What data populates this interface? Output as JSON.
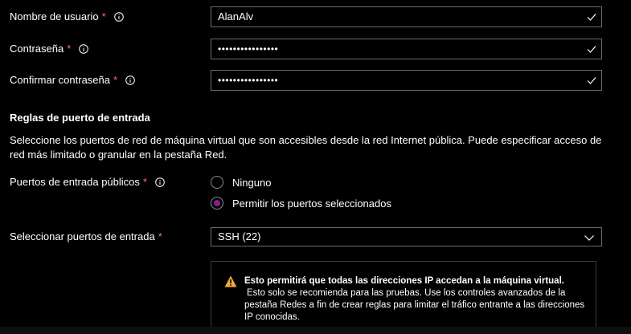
{
  "form": {
    "username": {
      "label": "Nombre de usuario",
      "required_mark": "*",
      "value": "AlanAlv"
    },
    "password": {
      "label": "Contraseña",
      "required_mark": "*",
      "value": "••••••••••••••••"
    },
    "confirm_password": {
      "label": "Confirmar contraseña",
      "required_mark": "*",
      "value": "••••••••••••••••"
    }
  },
  "inbound_rules": {
    "title": "Reglas de puerto de entrada",
    "description": "Seleccione los puertos de red de máquina virtual que son accesibles desde la red Internet pública. Puede especificar acceso de red más limitado o granular en la pestaña Red.",
    "public_ports": {
      "label": "Puertos de entrada públicos",
      "required_mark": "*",
      "options": [
        {
          "label": "Ninguno",
          "selected": false
        },
        {
          "label": "Permitir los puertos seleccionados",
          "selected": true
        }
      ]
    },
    "select_ports": {
      "label": "Seleccionar puertos de entrada",
      "required_mark": "*",
      "value": "SSH (22)"
    },
    "warning": {
      "bold_text": "Esto permitirá que todas las direcciones IP accedan a la máquina virtual.",
      "body_text": "Esto solo se recomienda para las pruebas.  Use los controles avanzados de la pestaña Redes a fin de crear reglas para limitar el tráfico entrante a las direcciones IP conocidas."
    }
  },
  "colors": {
    "background": "#000000",
    "required": "#f1707b",
    "radio_selected": "#8b1a8b",
    "warning_icon": "#f2a93b",
    "border": "#6b6b6b"
  },
  "icons": {
    "info": "info-icon",
    "check": "check-icon",
    "chevron": "chevron-down-icon",
    "warning": "warning-icon"
  }
}
